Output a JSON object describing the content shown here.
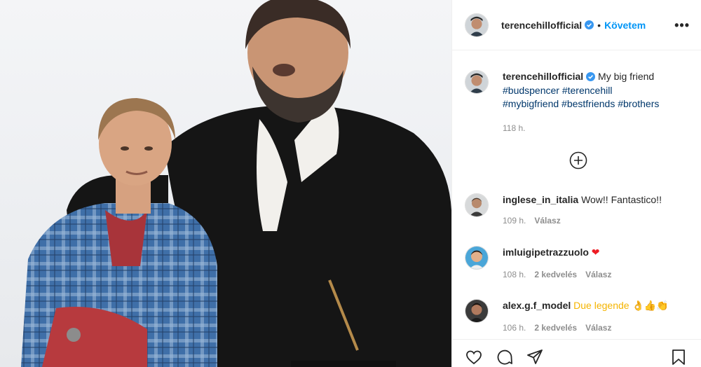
{
  "post": {
    "photo_alt": "",
    "header": {
      "username": "terencehillofficial",
      "separator": "•",
      "follow_label": "Követem",
      "more_label": "•••"
    },
    "caption": {
      "username": "terencehillofficial",
      "text": "My big friend",
      "hashtags": [
        "#budspencer",
        "#terencehill",
        "#mybigfriend",
        "#bestfriends",
        "#brothers"
      ],
      "time": "118 h."
    },
    "load_more_icon": "plus-circle-icon",
    "comments": [
      {
        "username": "inglese_in_italia",
        "text": "Wow!! Fantastico!!",
        "time": "109 h.",
        "likes": "",
        "reply": "Válasz"
      },
      {
        "username": "imluigipetrazzuolo",
        "text": "❤",
        "time": "108 h.",
        "likes": "2 kedvelés",
        "reply": "Válasz"
      },
      {
        "username": "alex.g.f_model",
        "text": "Due legende 👌👍👏",
        "time": "106 h.",
        "likes": "2 kedvelés",
        "reply": "Válasz"
      }
    ],
    "actions": [
      "heart-icon",
      "comment-icon",
      "share-icon",
      "bookmark-icon"
    ]
  },
  "colors": {
    "link": "#0095f6",
    "hashtag": "#00376b",
    "muted": "#8e8e8e",
    "text": "#262626",
    "heart": "#ed1c24"
  }
}
